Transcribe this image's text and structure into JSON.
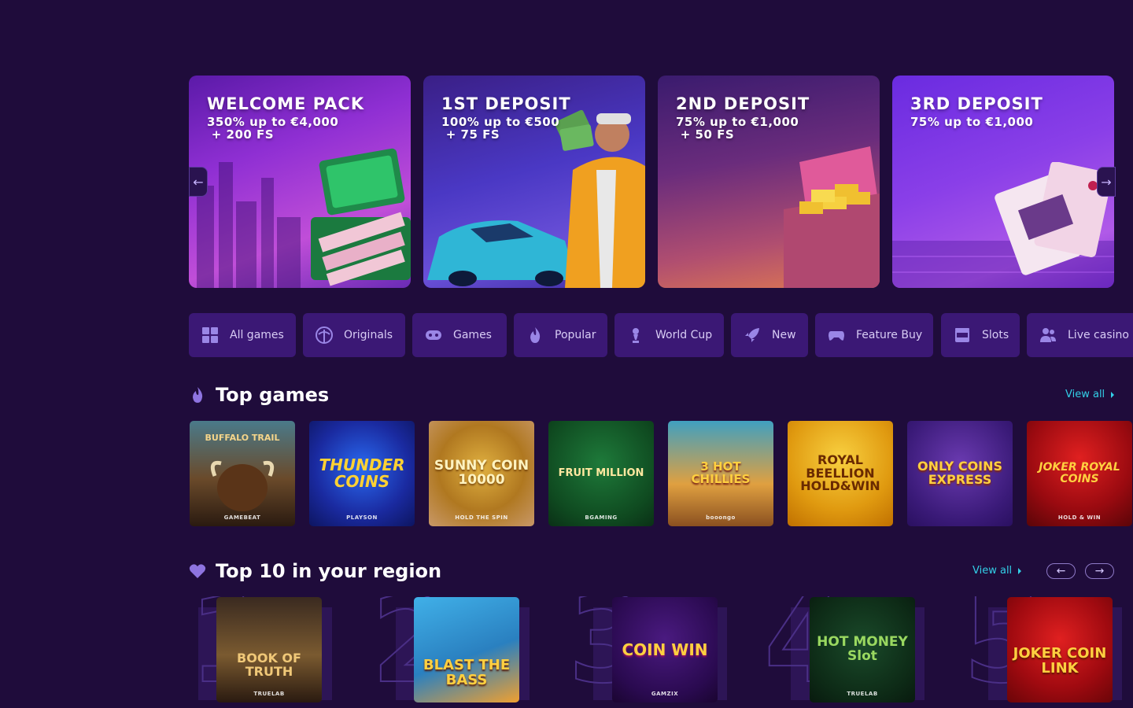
{
  "promos": [
    {
      "title": "WELCOME PACK",
      "sub": "350% up to €4,000\n + 200 FS"
    },
    {
      "title": "1ST DEPOSIT",
      "sub": "100% up to €500\n + 75 FS"
    },
    {
      "title": "2ND DEPOSIT",
      "sub": "75% up to €1,000\n + 50 FS"
    },
    {
      "title": "3RD DEPOSIT",
      "sub": "75% up to €1,000"
    }
  ],
  "carousel": {
    "prev": "←",
    "next": "→"
  },
  "categories": [
    {
      "label": "All games",
      "icon": "grid-icon"
    },
    {
      "label": "Originals",
      "icon": "palm-icon"
    },
    {
      "label": "Games",
      "icon": "gamepad-icon"
    },
    {
      "label": "Popular",
      "icon": "fire-icon"
    },
    {
      "label": "World Cup",
      "icon": "trophy-icon"
    },
    {
      "label": "New",
      "icon": "rocket-icon"
    },
    {
      "label": "Feature Buy",
      "icon": "controller-icon"
    },
    {
      "label": "Slots",
      "icon": "slot-machine-icon"
    },
    {
      "label": "Live casino",
      "icon": "users-icon"
    }
  ],
  "top_games": {
    "title": "Top games",
    "view_all": "View all",
    "games": [
      {
        "name": "BUFFALO TRAIL",
        "provider": "GAMEBEAT"
      },
      {
        "name": "THUNDER COINS",
        "provider": "PLAYSON"
      },
      {
        "name": "SUNNY COIN 10000",
        "provider": "HOLD THE SPIN"
      },
      {
        "name": "FRUIT MILLION",
        "provider": "BGAMING"
      },
      {
        "name": "3 HOT CHILLIES",
        "provider": "booongo"
      },
      {
        "name": "ROYAL BEELLION HOLD&WIN",
        "provider": ""
      },
      {
        "name": "ONLY COINS EXPRESS",
        "provider": ""
      },
      {
        "name": "JOKER ROYAL COINS",
        "provider": "HOLD & WIN"
      }
    ]
  },
  "top10": {
    "title": "Top 10 in your region",
    "view_all": "View all",
    "prev": "←",
    "next": "→",
    "games": [
      {
        "rank": "1",
        "name": "BOOK OF TRUTH",
        "provider": "TRUELAB"
      },
      {
        "rank": "2",
        "name": "BLAST THE BASS",
        "provider": ""
      },
      {
        "rank": "3",
        "name": "COIN WIN",
        "provider": "GAMZIX"
      },
      {
        "rank": "4",
        "name": "HOT MONEY Slot",
        "provider": "TRUELAB"
      },
      {
        "rank": "5",
        "name": "JOKER COIN LINK",
        "provider": ""
      }
    ]
  },
  "colors": {
    "background": "#1f0c3b",
    "accent_link": "#33d0e8",
    "category_bg": "#3b1875"
  }
}
